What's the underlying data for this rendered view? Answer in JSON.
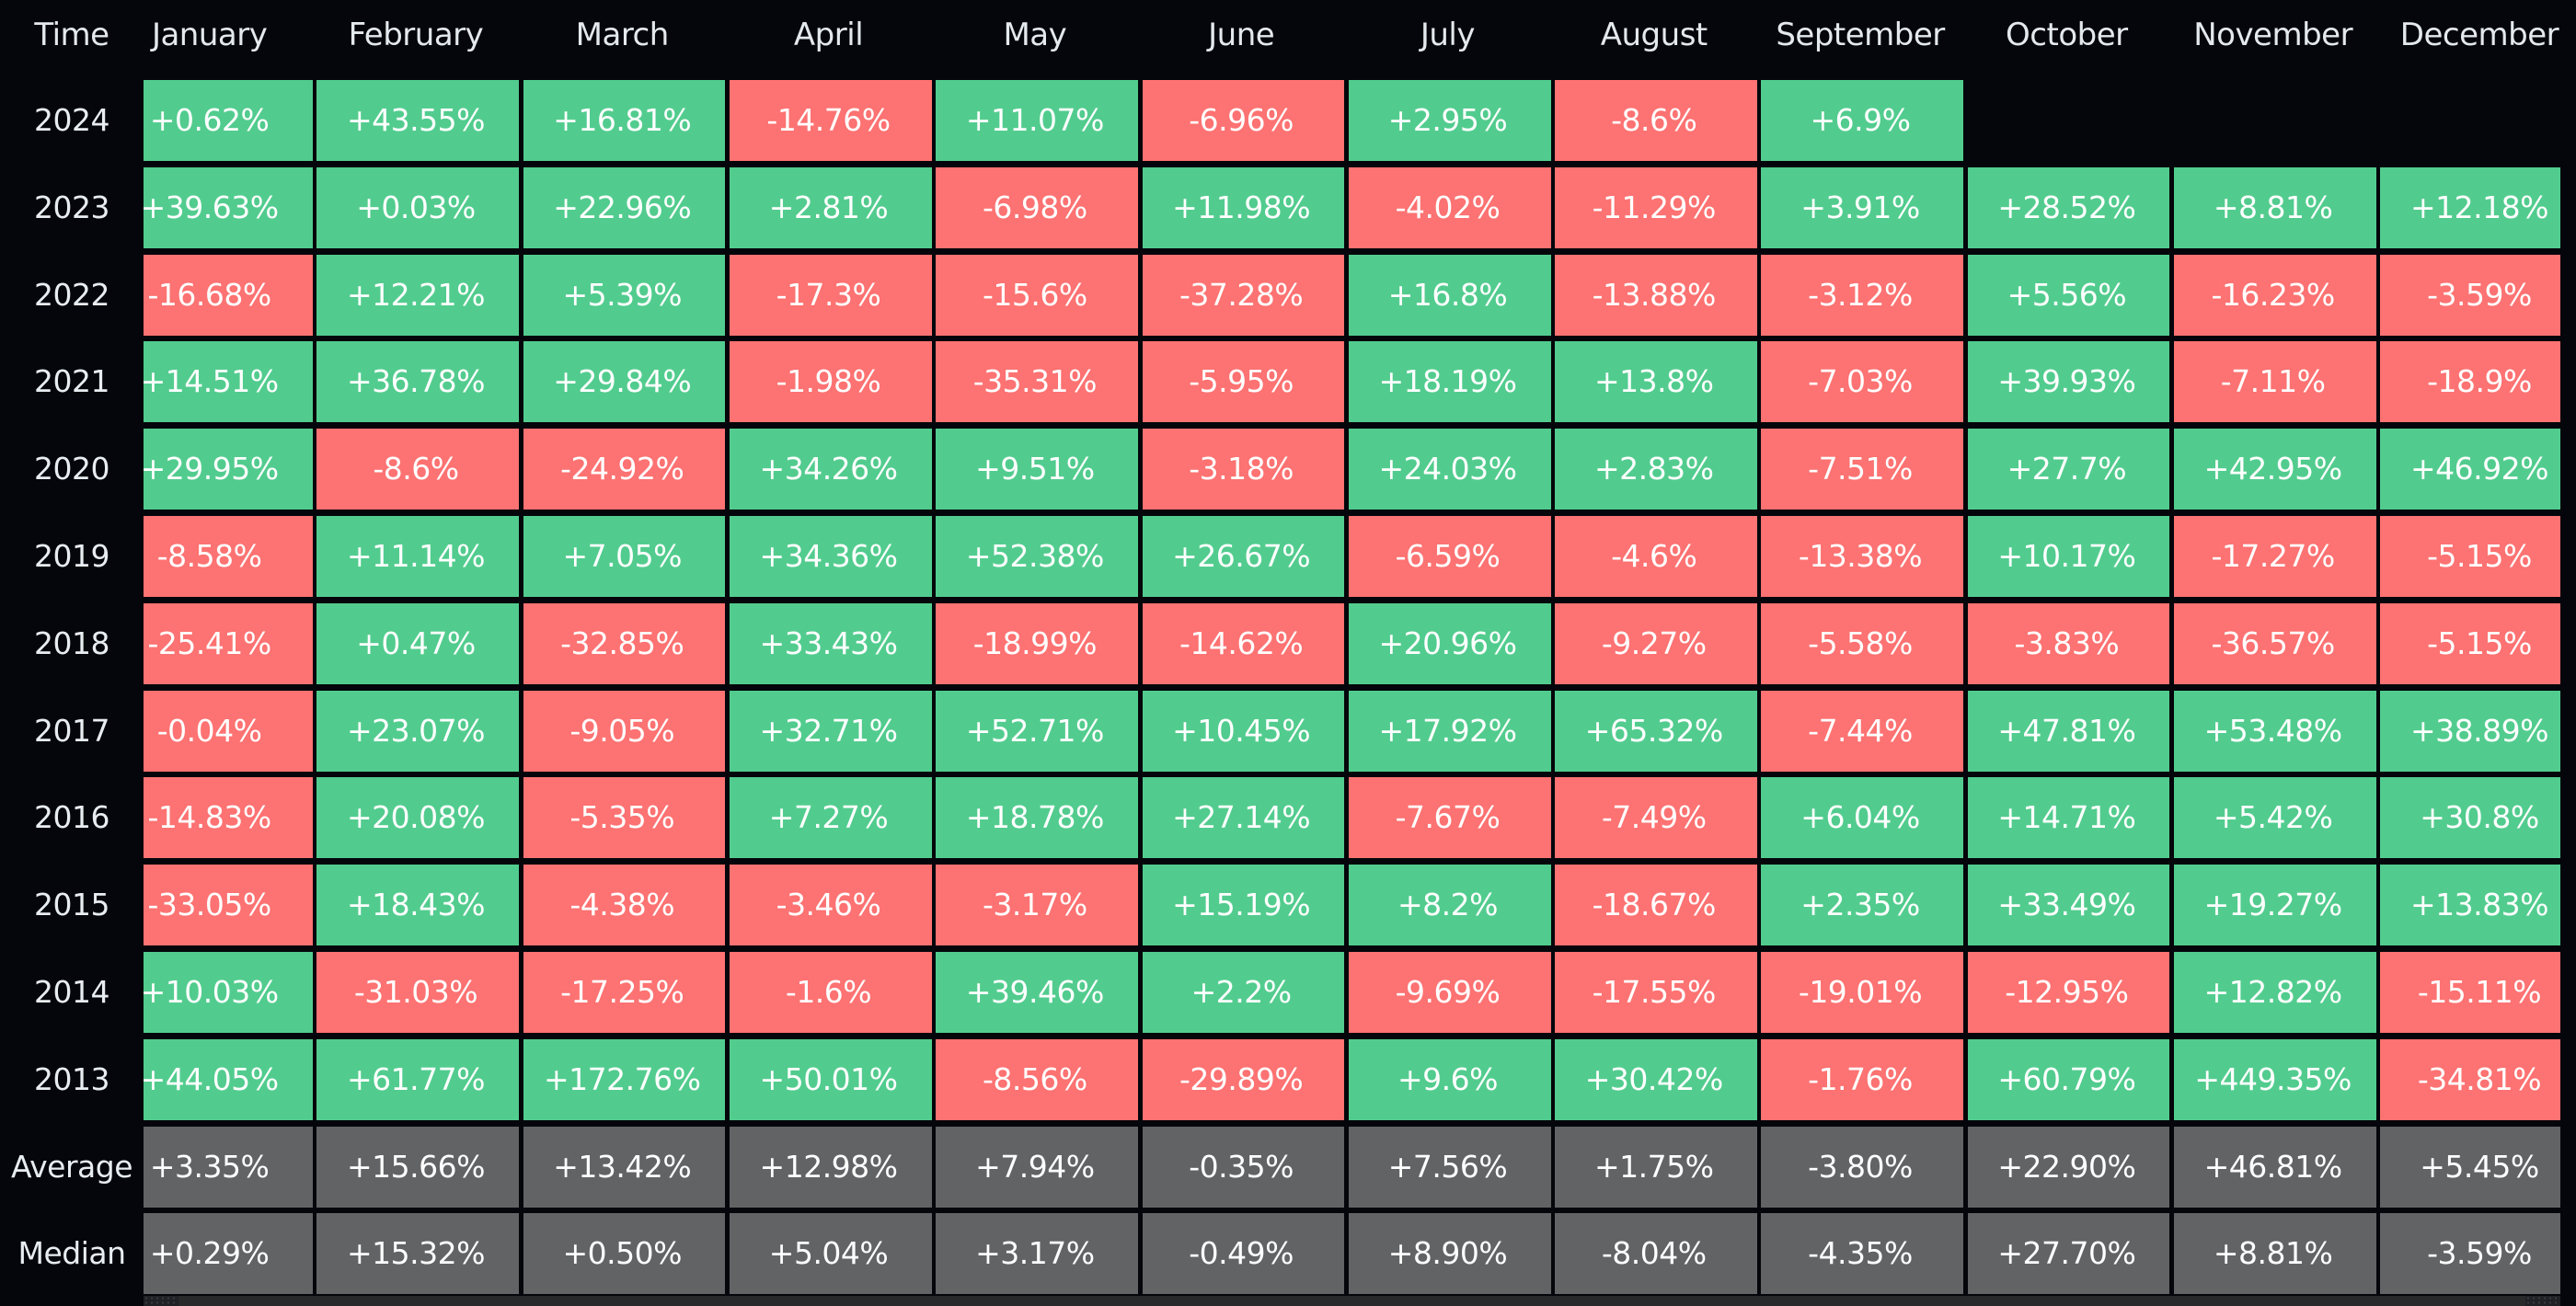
{
  "table": {
    "corner_label": "Time",
    "months": [
      "January",
      "February",
      "March",
      "April",
      "May",
      "June",
      "July",
      "August",
      "September",
      "October",
      "November",
      "December"
    ],
    "rows": [
      {
        "label": "2024",
        "kind": "year",
        "values": [
          "+0.62%",
          "+43.55%",
          "+16.81%",
          "-14.76%",
          "+11.07%",
          "-6.96%",
          "+2.95%",
          "-8.6%",
          "+6.9%",
          null,
          null,
          null
        ]
      },
      {
        "label": "2023",
        "kind": "year",
        "values": [
          "+39.63%",
          "+0.03%",
          "+22.96%",
          "+2.81%",
          "-6.98%",
          "+11.98%",
          "-4.02%",
          "-11.29%",
          "+3.91%",
          "+28.52%",
          "+8.81%",
          "+12.18%"
        ]
      },
      {
        "label": "2022",
        "kind": "year",
        "values": [
          "-16.68%",
          "+12.21%",
          "+5.39%",
          "-17.3%",
          "-15.6%",
          "-37.28%",
          "+16.8%",
          "-13.88%",
          "-3.12%",
          "+5.56%",
          "-16.23%",
          "-3.59%"
        ]
      },
      {
        "label": "2021",
        "kind": "year",
        "values": [
          "+14.51%",
          "+36.78%",
          "+29.84%",
          "-1.98%",
          "-35.31%",
          "-5.95%",
          "+18.19%",
          "+13.8%",
          "-7.03%",
          "+39.93%",
          "-7.11%",
          "-18.9%"
        ]
      },
      {
        "label": "2020",
        "kind": "year",
        "values": [
          "+29.95%",
          "-8.6%",
          "-24.92%",
          "+34.26%",
          "+9.51%",
          "-3.18%",
          "+24.03%",
          "+2.83%",
          "-7.51%",
          "+27.7%",
          "+42.95%",
          "+46.92%"
        ]
      },
      {
        "label": "2019",
        "kind": "year",
        "values": [
          "-8.58%",
          "+11.14%",
          "+7.05%",
          "+34.36%",
          "+52.38%",
          "+26.67%",
          "-6.59%",
          "-4.6%",
          "-13.38%",
          "+10.17%",
          "-17.27%",
          "-5.15%"
        ]
      },
      {
        "label": "2018",
        "kind": "year",
        "values": [
          "-25.41%",
          "+0.47%",
          "-32.85%",
          "+33.43%",
          "-18.99%",
          "-14.62%",
          "+20.96%",
          "-9.27%",
          "-5.58%",
          "-3.83%",
          "-36.57%",
          "-5.15%"
        ]
      },
      {
        "label": "2017",
        "kind": "year",
        "values": [
          "-0.04%",
          "+23.07%",
          "-9.05%",
          "+32.71%",
          "+52.71%",
          "+10.45%",
          "+17.92%",
          "+65.32%",
          "-7.44%",
          "+47.81%",
          "+53.48%",
          "+38.89%"
        ]
      },
      {
        "label": "2016",
        "kind": "year",
        "values": [
          "-14.83%",
          "+20.08%",
          "-5.35%",
          "+7.27%",
          "+18.78%",
          "+27.14%",
          "-7.67%",
          "-7.49%",
          "+6.04%",
          "+14.71%",
          "+5.42%",
          "+30.8%"
        ]
      },
      {
        "label": "2015",
        "kind": "year",
        "values": [
          "-33.05%",
          "+18.43%",
          "-4.38%",
          "-3.46%",
          "-3.17%",
          "+15.19%",
          "+8.2%",
          "-18.67%",
          "+2.35%",
          "+33.49%",
          "+19.27%",
          "+13.83%"
        ]
      },
      {
        "label": "2014",
        "kind": "year",
        "values": [
          "+10.03%",
          "-31.03%",
          "-17.25%",
          "-1.6%",
          "+39.46%",
          "+2.2%",
          "-9.69%",
          "-17.55%",
          "-19.01%",
          "-12.95%",
          "+12.82%",
          "-15.11%"
        ]
      },
      {
        "label": "2013",
        "kind": "year",
        "values": [
          "+44.05%",
          "+61.77%",
          "+172.76%",
          "+50.01%",
          "-8.56%",
          "-29.89%",
          "+9.6%",
          "+30.42%",
          "-1.76%",
          "+60.79%",
          "+449.35%",
          "-34.81%"
        ]
      },
      {
        "label": "Average",
        "kind": "stat",
        "values": [
          "+3.35%",
          "+15.66%",
          "+13.42%",
          "+12.98%",
          "+7.94%",
          "-0.35%",
          "+7.56%",
          "+1.75%",
          "-3.80%",
          "+22.90%",
          "+46.81%",
          "+5.45%"
        ]
      },
      {
        "label": "Median",
        "kind": "stat",
        "values": [
          "+0.29%",
          "+15.32%",
          "+0.50%",
          "+5.04%",
          "+3.17%",
          "-0.49%",
          "+8.90%",
          "-8.04%",
          "-4.35%",
          "+27.70%",
          "+8.81%",
          "-3.59%"
        ]
      }
    ]
  },
  "colors": {
    "background": "#04060b",
    "positive": "#52cc8e",
    "negative": "#fd7272",
    "stat": "#626365",
    "header_text": "#e4e9ee",
    "cell_text": "#ffffff",
    "scrollbar_track": "#28292b"
  },
  "scrollbar": {
    "orientation": "horizontal"
  }
}
